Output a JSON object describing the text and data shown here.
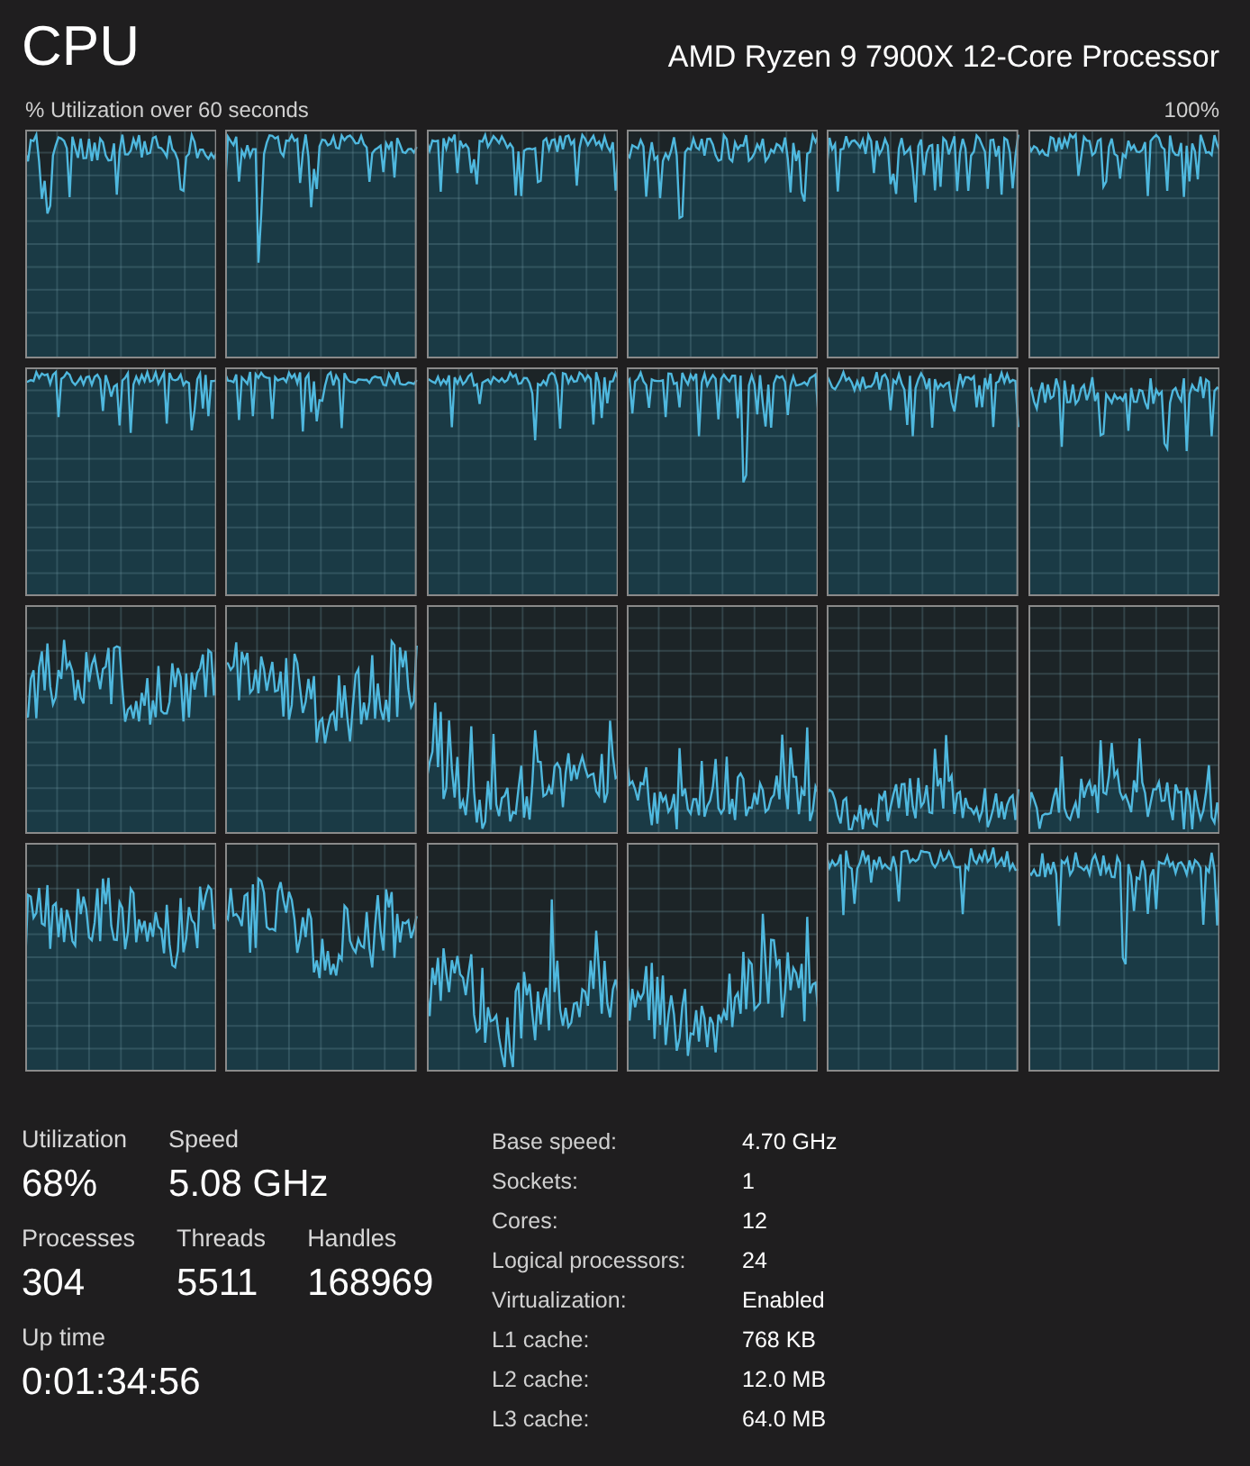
{
  "header": {
    "title": "CPU",
    "processor": "AMD Ryzen 9 7900X 12-Core Processor"
  },
  "graphs": {
    "caption": "% Utilization over 60 seconds",
    "max_label": "100%"
  },
  "stats": [
    [
      {
        "label": "Utilization",
        "value": "68%"
      },
      {
        "label": "Speed",
        "value": "5.08 GHz"
      }
    ],
    [
      {
        "label": "Processes",
        "value": "304"
      },
      {
        "label": "Threads",
        "value": "5511"
      },
      {
        "label": "Handles",
        "value": "168969"
      }
    ],
    [
      {
        "label": "Up time",
        "value": "0:01:34:56"
      }
    ]
  ],
  "details": [
    {
      "label": "Base speed:",
      "value": "4.70 GHz"
    },
    {
      "label": "Sockets:",
      "value": "1"
    },
    {
      "label": "Cores:",
      "value": "12"
    },
    {
      "label": "Logical processors:",
      "value": "24"
    },
    {
      "label": "Virtualization:",
      "value": "Enabled"
    },
    {
      "label": "L1 cache:",
      "value": "768 KB"
    },
    {
      "label": "L2 cache:",
      "value": "12.0 MB"
    },
    {
      "label": "L3 cache:",
      "value": "64.0 MB"
    }
  ]
}
